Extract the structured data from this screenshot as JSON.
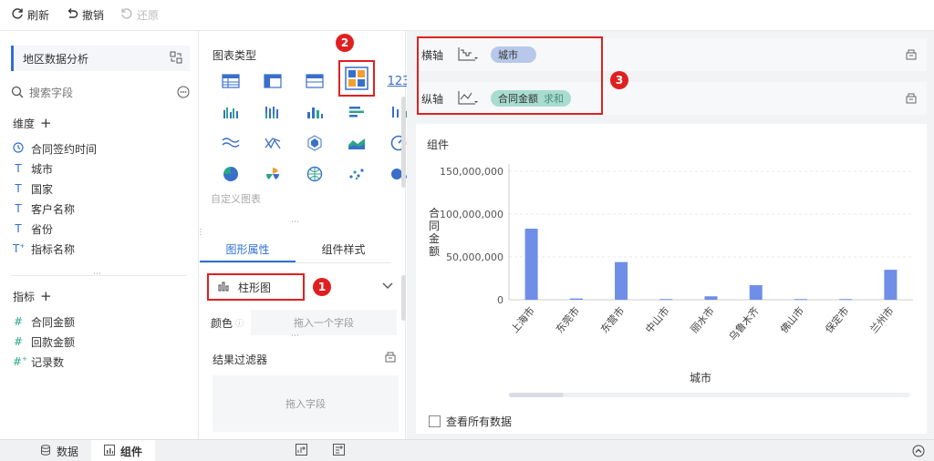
{
  "toolbar": {
    "refresh_label": "刷新",
    "undo_label": "撤销",
    "redo_label": "还原"
  },
  "left": {
    "dataset_name": "地区数据分析",
    "search_placeholder": "搜索字段",
    "dimension_title": "维度",
    "dimensions": [
      {
        "label": "合同签约时间",
        "icon": "clock-icon"
      },
      {
        "label": "城市",
        "icon": "text-icon"
      },
      {
        "label": "国家",
        "icon": "text-icon"
      },
      {
        "label": "客户名称",
        "icon": "text-icon"
      },
      {
        "label": "省份",
        "icon": "text-icon"
      },
      {
        "label": "指标名称",
        "icon": "text-plus-icon"
      }
    ],
    "measure_title": "指标",
    "measures": [
      {
        "label": "合同金额",
        "icon": "hash-icon"
      },
      {
        "label": "回款金额",
        "icon": "hash-icon"
      },
      {
        "label": "记录数",
        "icon": "hash-plus-icon"
      }
    ]
  },
  "middle": {
    "chart_type_title": "图表类型",
    "custom_chart_label": "自定义图表",
    "tab_shape": "图形属性",
    "tab_style": "组件样式",
    "chart_type_selected": "柱形图",
    "color_label": "颜色",
    "drag_field_hint": "拖入一个字段",
    "result_filter_title": "结果过滤器",
    "drag_field_filter": "拖入字段"
  },
  "annotations": {
    "one": "1",
    "two": "2",
    "three": "3"
  },
  "right": {
    "x_axis_label": "横轴",
    "x_axis_field": "城市",
    "y_axis_label": "纵轴",
    "y_axis_field": "合同金额",
    "y_axis_agg": "求和",
    "component_title": "组件",
    "view_all_data_label": "查看所有数据"
  },
  "bottom": {
    "tab_data": "数据",
    "tab_component": "组件"
  },
  "colors": {
    "accent": "#2f6fd6",
    "bar": "#6e8ee8",
    "annotation": "#e02020",
    "x_pill": "#b7c8ea",
    "y_pill": "#a8dccf"
  },
  "chart_data": {
    "type": "bar",
    "categories": [
      "上海市",
      "东莞市",
      "东营市",
      "中山市",
      "丽水市",
      "乌鲁木齐",
      "佛山市",
      "保定市",
      "兰州市"
    ],
    "values": [
      83000000,
      1500000,
      44000000,
      800000,
      4000000,
      17000000,
      800000,
      800000,
      35000000
    ],
    "xlabel": "城市",
    "ylabel": "合同金额",
    "ylim": [
      0,
      150000000
    ],
    "yticks": [
      "150,000,000",
      "100,000,000",
      "50,000,000",
      "0"
    ],
    "grid": true
  }
}
